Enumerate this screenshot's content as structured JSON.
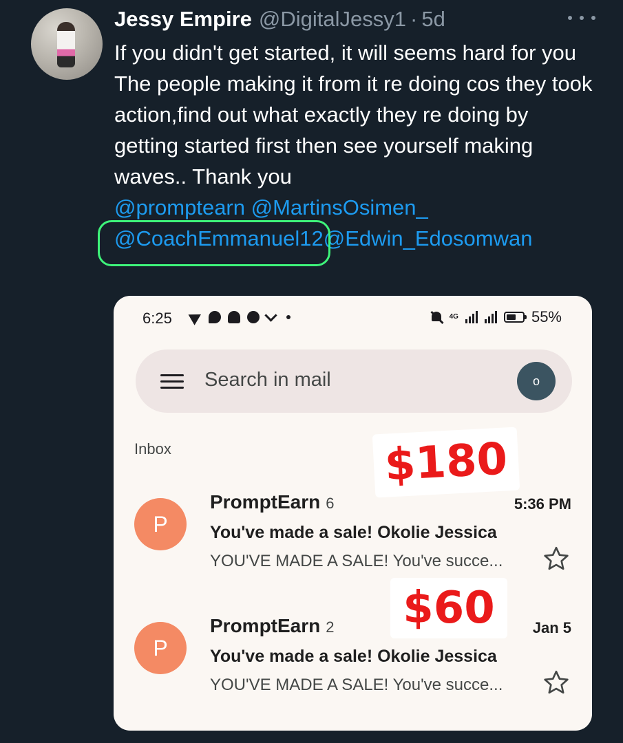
{
  "tweet": {
    "display_name": "Jessy Empire",
    "handle": "@DigitalJessy1",
    "separator": "·",
    "age": "5d",
    "text_lines": [
      "If you didn't get started, it will seems hard for you",
      "The people making it from it re doing cos they took action,find out what exactly they re doing by getting started first then see yourself making waves.. Thank you"
    ],
    "mentions": [
      "@promptearn",
      "@MartinsOsimen_",
      "@CoachEmmanuel12",
      "@Edwin_Edosomwan"
    ],
    "highlight_color": "#3ef37a"
  },
  "phone": {
    "status_bar": {
      "time": "6:25",
      "network": "4G",
      "battery": "55%"
    },
    "search": {
      "placeholder": "Search in mail",
      "account_initial": "o"
    },
    "inbox_label": "Inbox",
    "stickers": [
      "$180",
      "$60"
    ],
    "emails": [
      {
        "avatar_letter": "P",
        "sender": "PromptEarn",
        "count": "6",
        "date": "5:36 PM",
        "subject": "You've made a sale! Okolie Jessica",
        "snippet": "YOU'VE MADE A SALE! You've succe..."
      },
      {
        "avatar_letter": "P",
        "sender": "PromptEarn",
        "count": "2",
        "date": "Jan 5",
        "subject": "You've made a sale! Okolie Jessica",
        "snippet": "YOU'VE MADE A SALE! You've succe..."
      }
    ]
  },
  "colors": {
    "background": "#16202a",
    "link": "#1d9bf0",
    "muted": "#8b98a5",
    "sticker_red": "#ea1a1a",
    "sender_avatar": "#f48a64"
  }
}
